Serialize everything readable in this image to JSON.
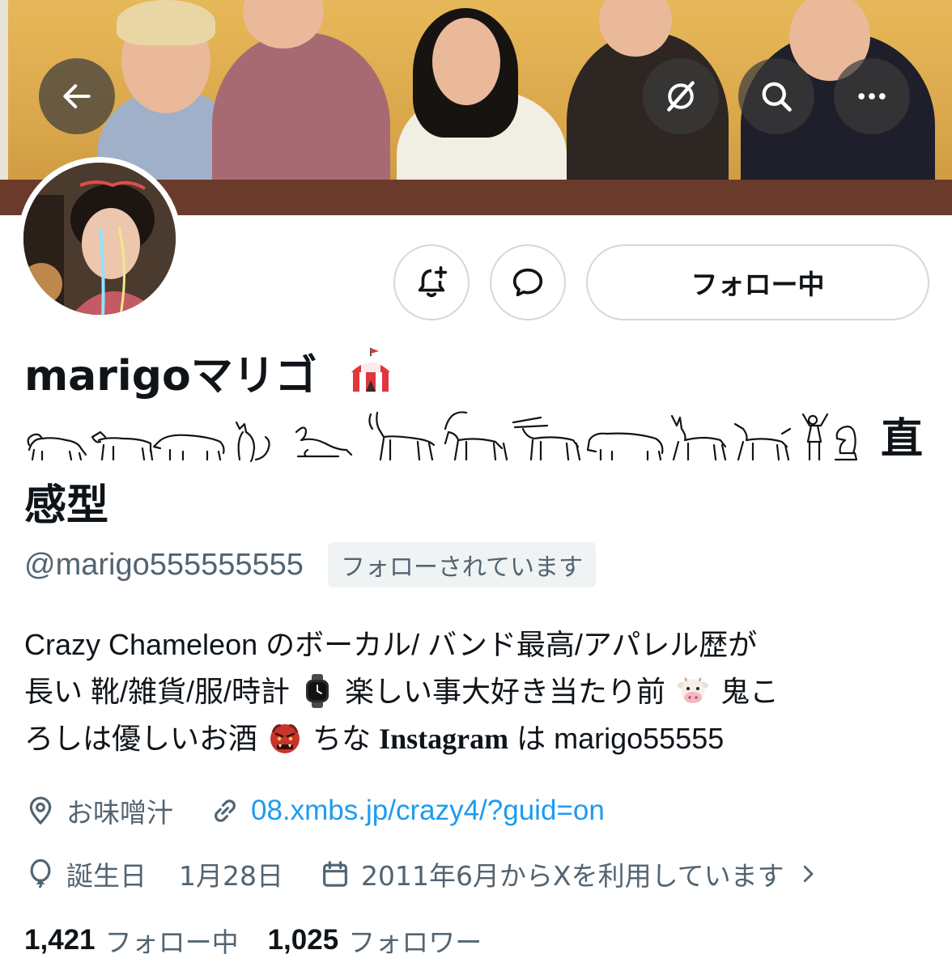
{
  "header": {
    "back_icon": "arrow-left-icon",
    "grok_icon": "grok-icon",
    "search_icon": "search-icon",
    "more_icon": "ellipsis-icon"
  },
  "actions": {
    "notify_icon": "bell-plus-icon",
    "message_icon": "chat-bubble-icon",
    "follow_label": "フォロー中"
  },
  "profile": {
    "display_name_prefix": "marigoマリゴ",
    "display_name_suffix_1": "直",
    "display_name_suffix_2": "感型",
    "handle": "@marigo555555555",
    "follows_you": "フォローされています",
    "bio_line1": "Crazy Chameleon のボーカル/ バンド最高/アパレル歴が",
    "bio_line2a": "長い 靴/雑貨/服/時計",
    "bio_line2b": "楽しい事大好き当たり前",
    "bio_line2c": "鬼こ",
    "bio_line3a": "ろしは優しいお酒",
    "bio_line3b": "ちな",
    "bio_line3c": "Instagram",
    "bio_line3d": "は marigo55555",
    "location": "お味噌汁",
    "website": "08.xmbs.jp/crazy4/?guid=on",
    "birthday_label": "誕生日",
    "birthday_value": "1月28日",
    "joined": "2011年6月からXを利用しています"
  },
  "stats": {
    "following_count": "1,421",
    "following_label": "フォロー中",
    "followers_count": "1,025",
    "followers_label": "フォロワー"
  },
  "colors": {
    "text": "#0f1419",
    "muted": "#536471",
    "link": "#1d9bf0",
    "border": "#cfd9de"
  }
}
